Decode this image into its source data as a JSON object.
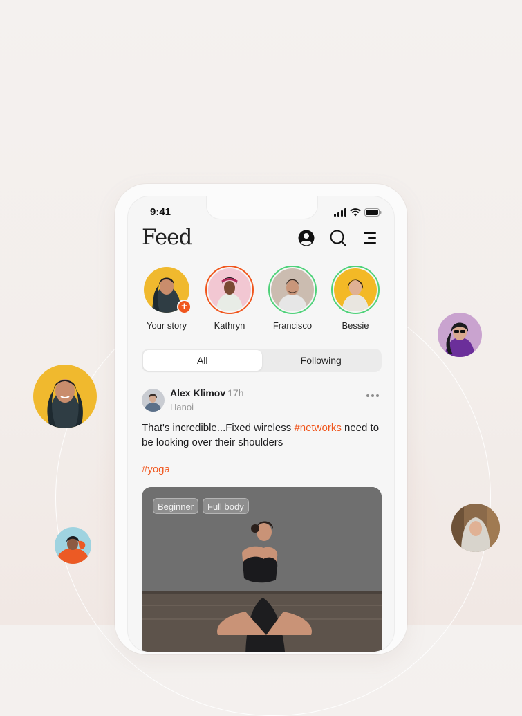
{
  "status_bar": {
    "time": "9:41"
  },
  "header": {
    "title": "Feed",
    "icons": [
      "profile-icon",
      "search-icon",
      "menu-icon"
    ]
  },
  "stories": [
    {
      "name": "Your story",
      "ring_color": "none",
      "has_add_badge": true,
      "badge_symbol": "+"
    },
    {
      "name": "Kathryn",
      "ring_color": "#f0561d"
    },
    {
      "name": "Francisco",
      "ring_color": "#4fd27a"
    },
    {
      "name": "Bessie",
      "ring_color": "#4fd27a"
    }
  ],
  "tabs": {
    "selected": "All",
    "items": [
      "All",
      "Following"
    ]
  },
  "post": {
    "author": "Alex Klimov",
    "time": "17h",
    "location": "Hanoi",
    "text_before": "That's incredible...Fixed wireless ",
    "text_hashtag": "#networks",
    "text_after": " need to be looking over their shoulders",
    "tag": "#yoga",
    "image_chips": [
      "Beginner",
      "Full body"
    ]
  },
  "colors": {
    "accent": "#f0561d",
    "story_ring_green": "#4fd27a",
    "background": "#f4f1ef"
  }
}
